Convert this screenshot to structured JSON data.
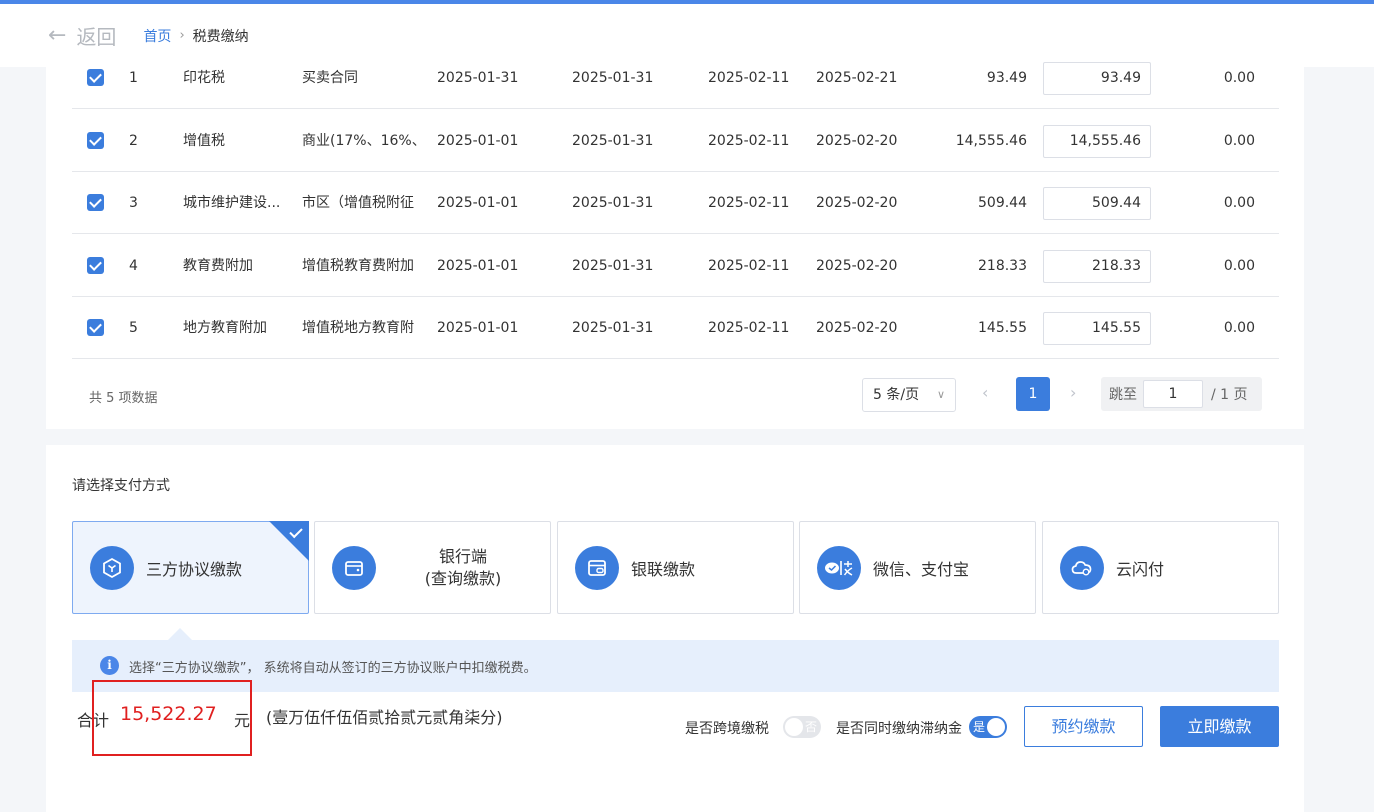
{
  "header": {
    "back_label": "返回",
    "breadcrumb_home": "首页",
    "breadcrumb_current": "税费缴纳"
  },
  "table": {
    "rows": [
      {
        "idx": "1",
        "tax": "印花税",
        "item": "买卖合同",
        "start": "2025-01-31",
        "end": "2025-01-31",
        "date3": "2025-02-11",
        "deadline": "2025-02-21",
        "amount": "93.49",
        "pay": "93.49",
        "late": "0.00"
      },
      {
        "idx": "2",
        "tax": "增值税",
        "item": "商业(17%、16%、",
        "start": "2025-01-01",
        "end": "2025-01-31",
        "date3": "2025-02-11",
        "deadline": "2025-02-20",
        "amount": "14,555.46",
        "pay": "14,555.46",
        "late": "0.00"
      },
      {
        "idx": "3",
        "tax": "城市维护建设...",
        "item": "市区（增值税附征",
        "start": "2025-01-01",
        "end": "2025-01-31",
        "date3": "2025-02-11",
        "deadline": "2025-02-20",
        "amount": "509.44",
        "pay": "509.44",
        "late": "0.00"
      },
      {
        "idx": "4",
        "tax": "教育费附加",
        "item": "增值税教育费附加",
        "start": "2025-01-01",
        "end": "2025-01-31",
        "date3": "2025-02-11",
        "deadline": "2025-02-20",
        "amount": "218.33",
        "pay": "218.33",
        "late": "0.00"
      },
      {
        "idx": "5",
        "tax": "地方教育附加",
        "item": "增值税地方教育附",
        "start": "2025-01-01",
        "end": "2025-01-31",
        "date3": "2025-02-11",
        "deadline": "2025-02-20",
        "amount": "145.55",
        "pay": "145.55",
        "late": "0.00"
      }
    ]
  },
  "pager": {
    "total": "共 5 项数据",
    "page_size": "5 条/页",
    "current": "1",
    "jump_label": "跳至",
    "jump_value": "1",
    "jump_tail": "/ 1 页"
  },
  "payment": {
    "title": "请选择支付方式",
    "methods": [
      {
        "label": "三方协议缴款"
      },
      {
        "label_line1": "银行端",
        "label_line2": "(查询缴款)"
      },
      {
        "label": "银联缴款"
      },
      {
        "label": "微信、支付宝"
      },
      {
        "label": "云闪付"
      }
    ],
    "tip": "选择“三方协议缴款”， 系统将自动从签订的三方协议账户中扣缴税费。"
  },
  "summary": {
    "total_label": "合计",
    "total_amount": "15,522.27",
    "unit": "元",
    "amount_cn": "(壹万伍仟伍佰贰拾贰元贰角柒分)",
    "cross_border_label": "是否跨境缴税",
    "cross_border_state": "否",
    "late_fee_label": "是否同时缴纳滞纳金",
    "late_fee_state": "是",
    "reserve_button": "预约缴款",
    "pay_button": "立即缴款"
  },
  "colors": {
    "accent": "#3b7ddd",
    "alert": "#e02020"
  }
}
